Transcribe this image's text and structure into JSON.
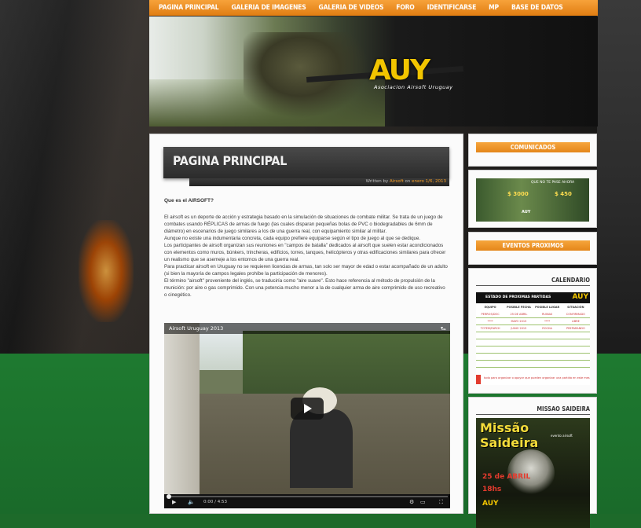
{
  "nav": {
    "items": [
      "Pagina Principal",
      "Galeria de Imagenes",
      "Galeria de Videos",
      "Foro",
      "Identificarse",
      "MP",
      "Base de Datos"
    ]
  },
  "banner": {
    "logo_text": "AUY",
    "logo_sub": "Asociacion Airsoft Uruguay"
  },
  "post": {
    "title": "PAGINA PRINCIPAL",
    "meta_prefix": "Written by ",
    "meta_author": "Airsoft",
    "meta_on": " on ",
    "meta_date": "enero 1/6, 2013",
    "question": "Que es el AIRSOFT?",
    "para1": "El airsoft es un deporte de acción y estrategia basado en la simulación de situaciones de combate militar. Se trata de un juego de combates usando RÉPLICAS de armas de fuego (las cuales disparan pequeñas bolas de PVC o biodegradables de 6mm de diámetro) en escenarios de juego similares a los de una guerra real, con equipamiento similar al militar.",
    "para2": "Aunque no existe una indumentaria concreta, cada equipo prefiere equiparse según el tipo de juego al que se dedique.",
    "para3": "Los participantes de airsoft organizan sus reuniones en \"campos de batalla\" dedicados al airsoft que suelen estar acondicionados con elementos como muros, búnkers, trincheras, edificios, torres, tanques, helicópteros y otras edificaciones similares para ofrecer un realismo que se asemeje a los entornos de una guerra real.",
    "para4": "Para practicar airsoft en Uruguay no se requieren licencias de armas, tan solo ser mayor de edad o estar acompañado de un adulto (si bien la mayoría de campos legales prohíbe la participación de menores).",
    "para5": "El término \"airsoft\" proveniente del inglés, se traduciría como \"aire suave\". Esto hace referencia al método de propulsión de la munición: por aire o gas comprimido. Con una potencia mucho menor a la de cualquier arma de aire comprimido de uso recreativo o cinegético."
  },
  "video": {
    "title": "Airsoft Uruguay 2013",
    "time": "0:00 / 4:53",
    "progress": 0
  },
  "sidebar": {
    "comunicados": "Comunicados",
    "ad": {
      "t1": "QUE NO TE PASE AHORA",
      "t2": "$ 3000",
      "t3": "$ 450",
      "t4": "AUY"
    },
    "eventos": "Eventos Proximos",
    "calendario": "Calendario",
    "calendar": {
      "header": "ESTADO DE PROXIMAS PARTIDAS",
      "logo": "AUY",
      "columns": [
        "EQUIPO ORGANIZADOR",
        "POSIBLE FECHA",
        "POSIBLE LUGAR",
        "SITUACIÓN"
      ],
      "rows": [
        [
          "PERROS/DOC",
          "25 DE ABRIL",
          "RUINAS",
          "CONFIRMADO"
        ],
        [
          "****",
          "MAYO 2015",
          "****",
          "LIBRE"
        ],
        [
          "TOTEM/FARCH",
          "JUNIO 2015",
          "ROCHA",
          "PREPARANDO"
        ]
      ],
      "footer": "todo para organizar o apoyar que pueden organizar una partida en este mes"
    },
    "missao": "Missao Saideira",
    "poster": {
      "title": "Missão Saideira",
      "sub": "evento airsoft",
      "date": "25 de ABRIL",
      "hour": "18hs",
      "logo": "AUY"
    }
  }
}
